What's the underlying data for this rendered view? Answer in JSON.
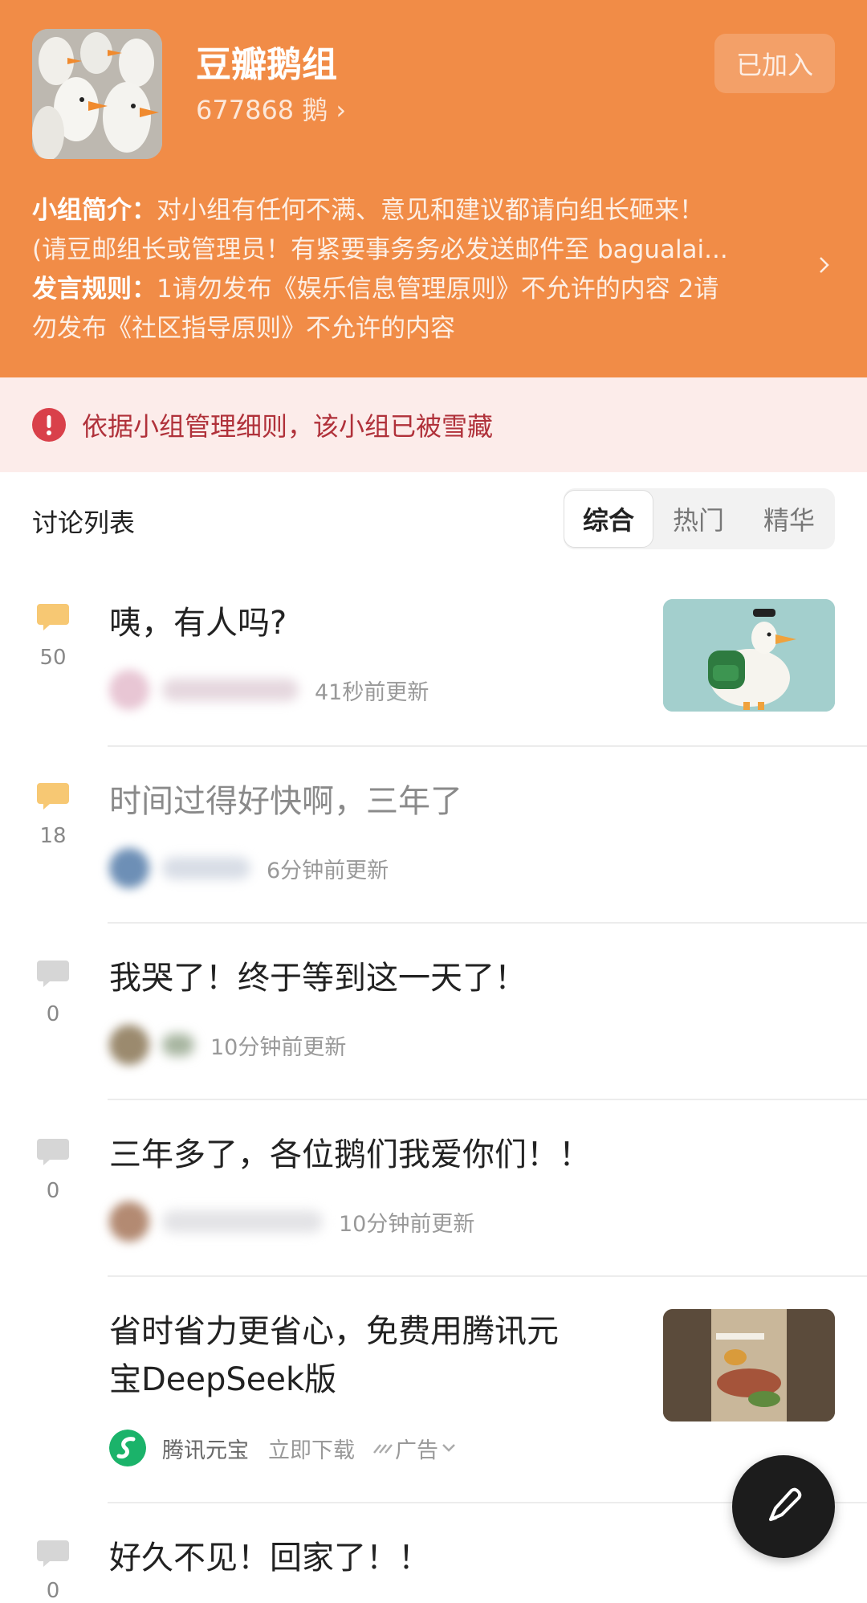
{
  "group": {
    "name": "豆瓣鹅组",
    "members": "677868 鹅",
    "join_button": "已加入"
  },
  "intro": {
    "intro_label": "小组简介：",
    "intro_line1": "对小组有任何不满、意见和建议都请向组长砸来！",
    "intro_line2": "(请豆邮组长或管理员！有紧要事务务必发送邮件至 bagualai...",
    "rules_label": "发言规则：",
    "rules_line1": "1请勿发布《娱乐信息管理原则》不允许的内容 2请",
    "rules_line2": "勿发布《社区指导原则》不允许的内容"
  },
  "banner": {
    "text": "依据小组管理细则，该小组已被雪藏"
  },
  "list": {
    "title": "讨论列表",
    "tabs": [
      "综合",
      "热门",
      "精华"
    ],
    "active_tab": "综合"
  },
  "posts": [
    {
      "count": "50",
      "title": "咦，有人吗?",
      "time": "41秒前更新",
      "count_color": "#f7c873"
    },
    {
      "count": "18",
      "title": "时间过得好快啊，三年了",
      "time": "6分钟前更新",
      "count_color": "#f7c873"
    },
    {
      "count": "0",
      "title": "我哭了！终于等到这一天了！",
      "time": "10分钟前更新",
      "count_color": "#d6d6d6"
    },
    {
      "count": "0",
      "title": "三年多了，各位鹅们我爱你们！！",
      "time": "10分钟前更新",
      "count_color": "#d6d6d6"
    }
  ],
  "ad": {
    "title_line1": "省时省力更省心，免费用腾讯元",
    "title_line2": "宝DeepSeek版",
    "advertiser": "腾讯元宝",
    "action": "立即下载",
    "tag": "广告"
  },
  "last_post": {
    "count": "0",
    "title": "好久不见！回家了！！"
  },
  "colors": {
    "header": "#f18c47",
    "banner_bg": "#fcecea",
    "banner_text": "#b0313a",
    "fab": "#1c1c1c"
  }
}
